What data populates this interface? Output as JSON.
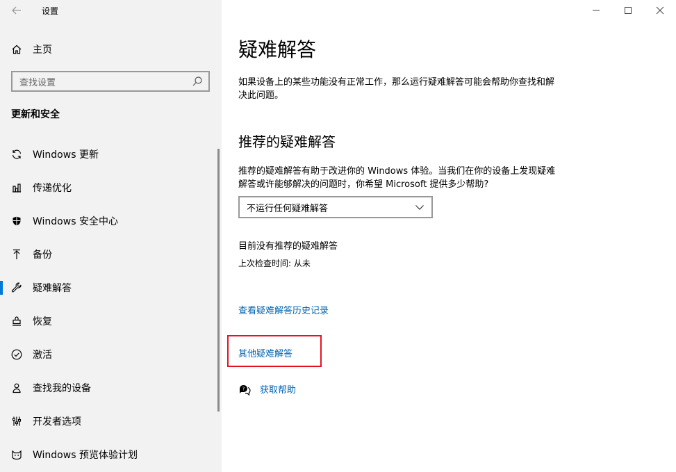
{
  "window": {
    "title": "设置",
    "back_icon": "arrow-left-icon",
    "controls": [
      "minimize-icon",
      "maximize-icon",
      "close-icon"
    ]
  },
  "sidebar": {
    "home_label": "主页",
    "search_placeholder": "查找设置",
    "section_title": "更新和安全",
    "items": [
      {
        "label": "Windows 更新",
        "icon": "sync-icon",
        "active": false
      },
      {
        "label": "传递优化",
        "icon": "delivery-icon",
        "active": false
      },
      {
        "label": "Windows 安全中心",
        "icon": "shield-icon",
        "active": false
      },
      {
        "label": "备份",
        "icon": "upload-arrow-icon",
        "active": false
      },
      {
        "label": "疑难解答",
        "icon": "wrench-icon",
        "active": true
      },
      {
        "label": "恢复",
        "icon": "recovery-icon",
        "active": false
      },
      {
        "label": "激活",
        "icon": "check-circle-icon",
        "active": false
      },
      {
        "label": "查找我的设备",
        "icon": "person-pin-icon",
        "active": false
      },
      {
        "label": "开发者选项",
        "icon": "developer-icon",
        "active": false
      },
      {
        "label": "Windows 预览体验计划",
        "icon": "smiley-cat-icon",
        "active": false
      }
    ]
  },
  "main": {
    "title": "疑难解答",
    "description": "如果设备上的某些功能没有正常工作，那么运行疑难解答可能会帮助你查找和解决此问题。",
    "recommended_title": "推荐的疑难解答",
    "recommended_desc": "推荐的疑难解答有助于改进你的 Windows 体验。当我们在你的设备上发现疑难解答或许能够解决的问题时，你希望 Microsoft 提供多少帮助?",
    "select_value": "不运行任何疑难解答",
    "no_recommended": "目前没有推荐的疑难解答",
    "last_checked": "上次检查时间: 从未",
    "history_link": "查看疑难解答历史记录",
    "other_link": "其他疑难解答",
    "help_link": "获取帮助"
  },
  "colors": {
    "accent": "#0078d7",
    "link": "#0063b1",
    "highlight": "#e81123",
    "sidebar_bg": "#f2f2f2"
  }
}
